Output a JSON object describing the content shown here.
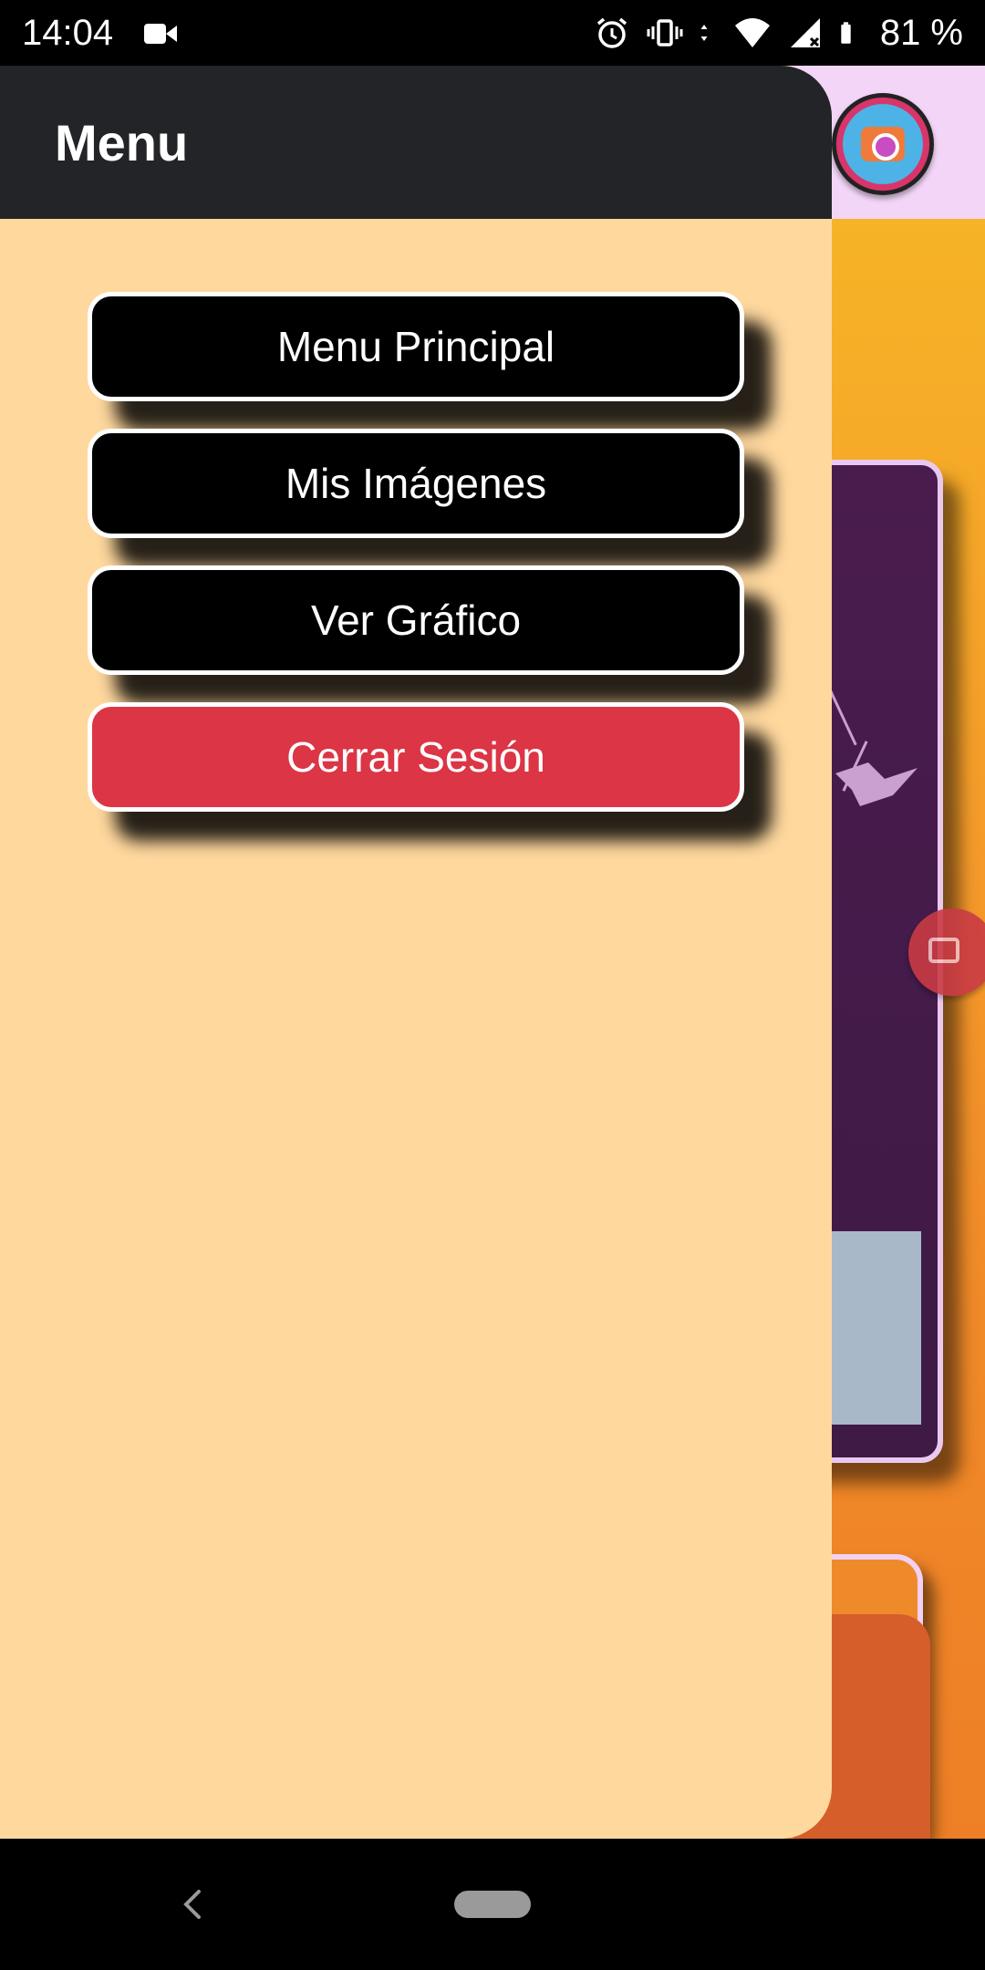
{
  "status_bar": {
    "time": "14:04",
    "battery_pct": "81 %",
    "icons": [
      "video-camera-icon",
      "alarm-icon",
      "vibrate-icon",
      "data-arrows-icon",
      "wifi-icon",
      "signal-icon",
      "battery-icon"
    ]
  },
  "drawer": {
    "title": "Menu",
    "items": [
      {
        "label": "Menu Principal",
        "style": "dark"
      },
      {
        "label": "Mis Imágenes",
        "style": "dark"
      },
      {
        "label": "Ver Gráfico",
        "style": "dark"
      },
      {
        "label": "Cerrar Sesión",
        "style": "danger"
      }
    ]
  },
  "colors": {
    "drawer_bg": "#ffd89e",
    "drawer_header_bg": "#232428",
    "button_dark": "#000000",
    "button_danger": "#dc3545",
    "app_header_bg": "#f3d5f8",
    "app_bg_orange": "#f6b926"
  },
  "nav_bar": {
    "icons": [
      "back-icon",
      "home-pill-icon"
    ]
  }
}
